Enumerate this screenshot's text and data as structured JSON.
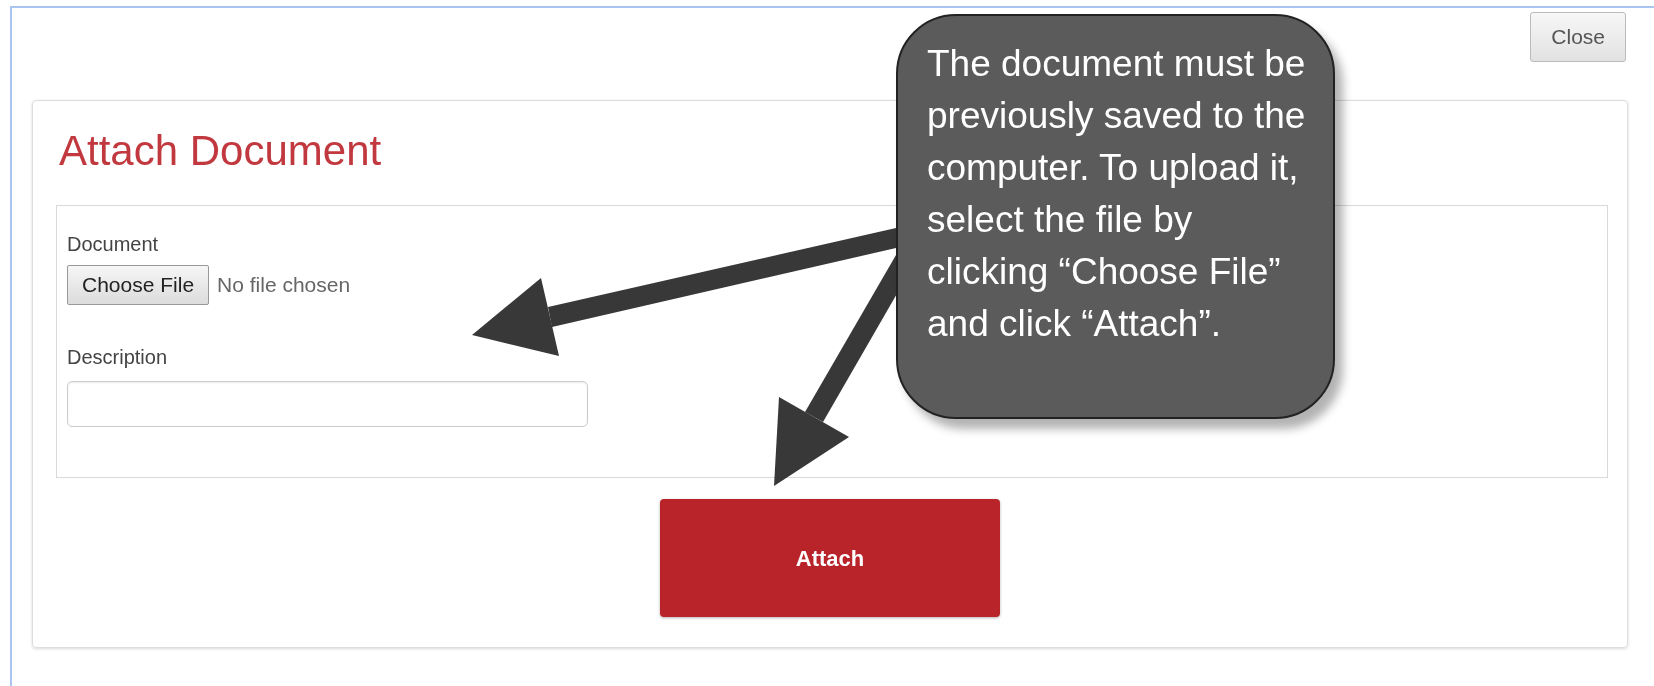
{
  "close_button": "Close",
  "form": {
    "title": "Attach Document",
    "fields": [
      {
        "kind": "file",
        "label": "Document",
        "button": "Choose File",
        "status": "No file chosen"
      },
      {
        "kind": "text",
        "label": "Description"
      }
    ],
    "submit": "Attach"
  },
  "callout": {
    "text": "The document must be previously saved to the computer. To upload it, select the file by clicking “Choose File” and click “Attach”."
  }
}
